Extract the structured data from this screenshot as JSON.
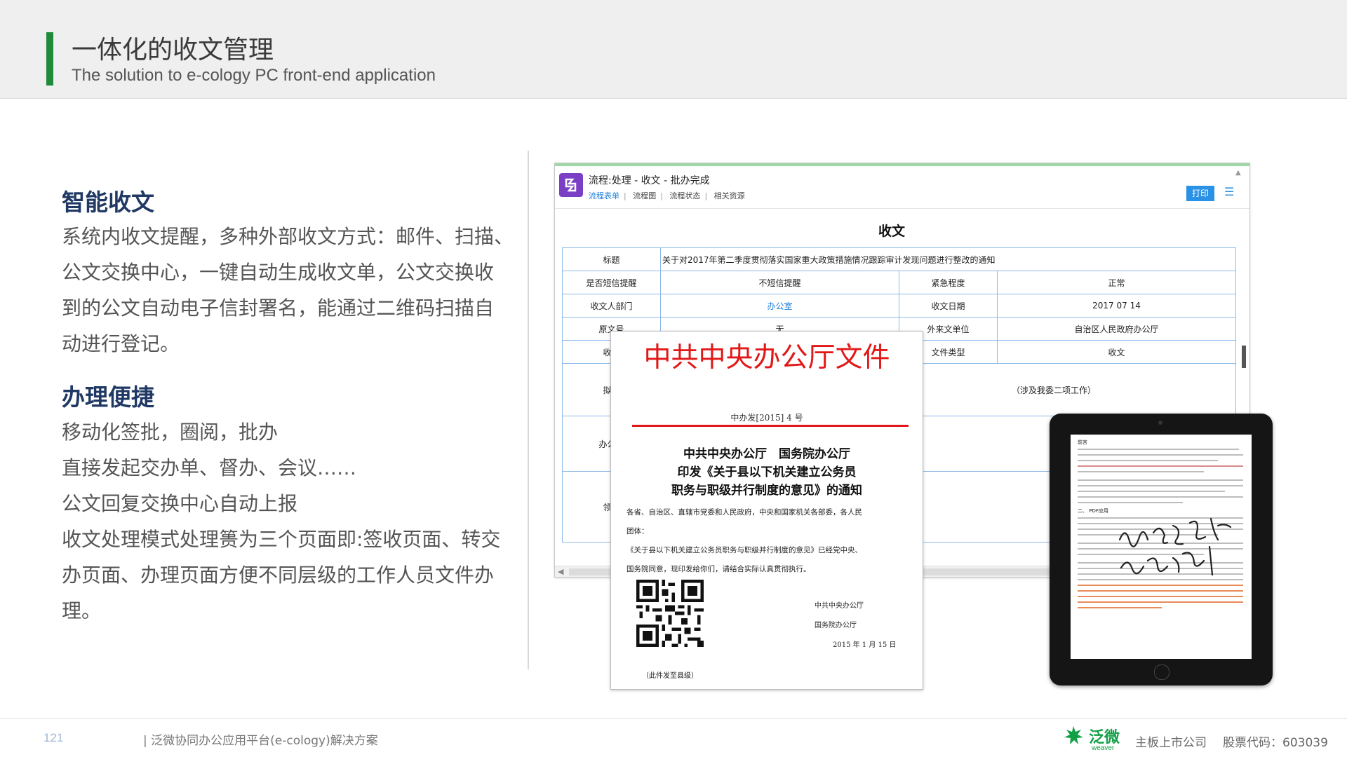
{
  "colors": {
    "accent_green": "#1e8a3a",
    "section_title": "#1f3864",
    "doc_red": "#e21818",
    "link_blue": "#1e7fd8"
  },
  "header": {
    "title": "一体化的收文管理",
    "subtitle": "The solution to e-cology PC front-end application"
  },
  "left": {
    "section1_title": "智能收文",
    "section1_lines": [
      "系统内收文提醒，多种外部收文方式：邮件、扫描、",
      "公文交换中心，一键自动生成收文单，公文交换收",
      "到的公文自动电子信封署名，能通过二维码扫描自",
      "动进行登记。"
    ],
    "section2_title": "办理便捷",
    "section2_lines": [
      "移动化签批，圈阅，批办",
      "直接发起交办单、督办、会议……",
      "公文回复交换中心自动上报",
      "收文处理模式处理篑为三个页面即:签收页面、转交",
      "办页面、办理页面方便不同层级的工作人员文件办",
      "理。"
    ]
  },
  "form": {
    "flow_title": "流程:处理 - 收文 - 批办完成",
    "tabs": [
      "流程表单",
      "流程图",
      "流程状态",
      "相关资源"
    ],
    "print_label": "打印",
    "heading": "收文",
    "title_label": "标题",
    "title_value": "关于对2017年第二季度贯彻落实国家重大政策措施情况跟踪审计发现问题进行整改的通知",
    "rows": [
      {
        "l1": "是否短信提醒",
        "v1": "不短信提醒",
        "l2": "紧急程度",
        "v2": "正常"
      },
      {
        "l1": "收文人部门",
        "v1": "办公室",
        "l2": "收文日期",
        "v2": "2017 07 14"
      },
      {
        "l1": "原文号",
        "v1": "无",
        "l2": "外来文单位",
        "v2": "自治区人民政府办公厅"
      },
      {
        "l1": "收文",
        "v1": "",
        "l2": "文件类型",
        "v2": "收文"
      }
    ],
    "row5_label": "拟办",
    "row5_value": "（涉及我委二项工作）",
    "row6_label": "办公室",
    "row7_label": "领导"
  },
  "document": {
    "header": "中共中央办公厅文件",
    "number": "中办发[2015] 4 号",
    "title_lines": [
      "中共中央办公厅　国务院办公厅",
      "印发《关于县以下机关建立公务员",
      "职务与职级并行制度的意见》的通知"
    ],
    "body_lines": [
      "各省、自治区、直辖市党委和人民政府，中央和国家机关各部委，各人民",
      "团体：",
      "《关于县以下机关建立公务员职务与职级并行制度的意见》已经党中央、",
      "国务院同意，现印发给你们，请结合实际认真贯彻执行。"
    ],
    "sign_lines": [
      "中共中央办公厅",
      "国务院办公厅",
      "2015 年 1 月 15 日"
    ],
    "note": "（此件发至县级）"
  },
  "tablet": {
    "heading": "前言",
    "section2": "二、 PDF应用"
  },
  "footer": {
    "page_number": "121",
    "text": "| 泛微协同办公应用平台(e-cology)解决方案",
    "brand": "泛微",
    "brand_en": "weaver",
    "company": "主板上市公司",
    "stock": "股票代码：603039"
  }
}
